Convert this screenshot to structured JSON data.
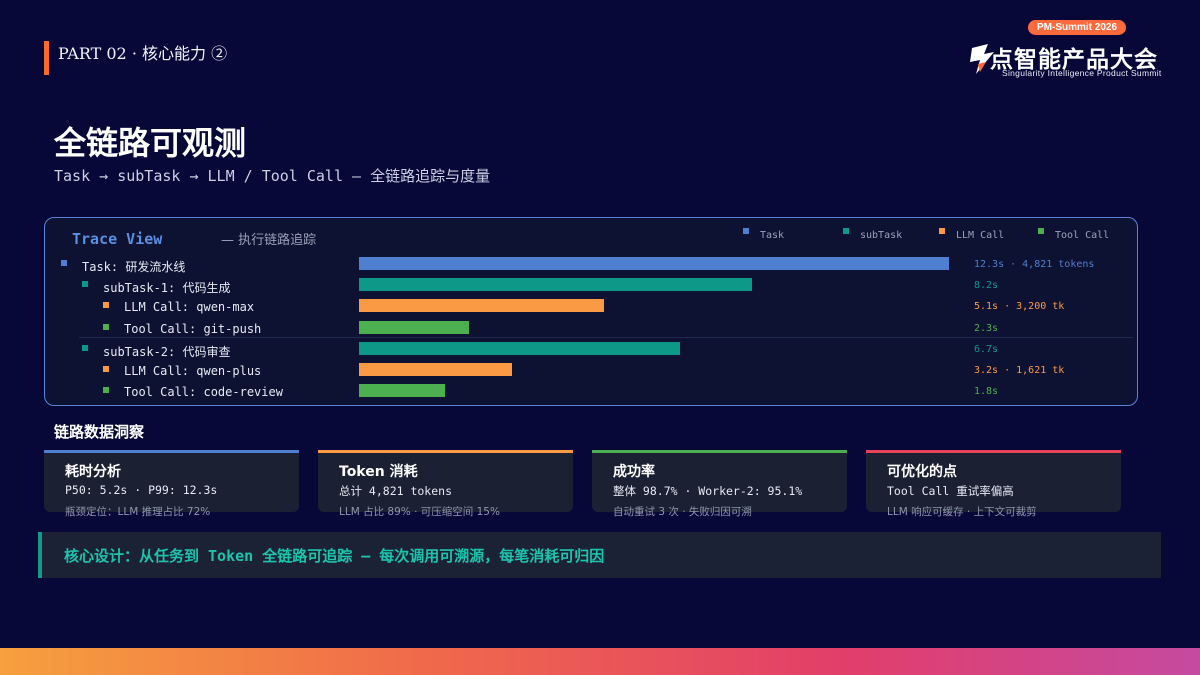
{
  "header": {
    "part_label": "PART 02 · 核心能力 ②",
    "logo": {
      "badge": "PM-Summit 2026",
      "name": "点智能产品大会",
      "subtitle": "Singularity Intelligence Product Summit",
      "icon": "summit-logo-icon"
    }
  },
  "title": "全链路可观测",
  "subtitle": "Task → subTask → LLM / Tool Call — 全链路追踪与度量",
  "trace": {
    "title": "Trace View",
    "subtitle": "— 执行链路追踪",
    "legend": [
      {
        "label": "Task",
        "color": "#4f7fd0"
      },
      {
        "label": "subTask",
        "color": "#0e9888"
      },
      {
        "label": "LLM Call",
        "color": "#fb9a44"
      },
      {
        "label": "Tool Call",
        "color": "#4caf50"
      }
    ],
    "rows": [
      {
        "label": "Task: 研发流水线",
        "kind": "task",
        "level": 0,
        "duration_s": 12.3,
        "value": "12.3s · 4,821 tokens"
      },
      {
        "label": "subTask-1: 代码生成",
        "kind": "subtask",
        "level": 1,
        "duration_s": 8.2,
        "value": "8.2s"
      },
      {
        "label": "LLM Call: qwen-max",
        "kind": "llm",
        "level": 2,
        "duration_s": 5.1,
        "value": "5.1s · 3,200 tk"
      },
      {
        "label": "Tool Call: git-push",
        "kind": "tool",
        "level": 2,
        "duration_s": 2.3,
        "value": "2.3s"
      },
      {
        "label": "subTask-2: 代码审查",
        "kind": "subtask",
        "level": 1,
        "duration_s": 6.7,
        "value": "6.7s"
      },
      {
        "label": "LLM Call: qwen-plus",
        "kind": "llm",
        "level": 2,
        "duration_s": 3.2,
        "value": "3.2s · 1,621 tk"
      },
      {
        "label": "Tool Call: code-review",
        "kind": "tool",
        "level": 2,
        "duration_s": 1.8,
        "value": "1.8s"
      }
    ]
  },
  "insights": {
    "title": "链路数据洞察",
    "cards": [
      {
        "title": "耗时分析",
        "line1": "P50: 5.2s  ·  P99: 12.3s",
        "line2": "瓶颈定位：LLM 推理占比 72%",
        "color": "#4f7fd0"
      },
      {
        "title": "Token 消耗",
        "line1": "总计 4,821 tokens",
        "line2": "LLM 占比 89% · 可压缩空间 15%",
        "color": "#fb9a44"
      },
      {
        "title": "成功率",
        "line1": "整体 98.7% · Worker-2: 95.1%",
        "line2": "自动重试 3 次 · 失败归因可溯",
        "color": "#4caf50"
      },
      {
        "title": "可优化的点",
        "line1": "Tool Call 重试率偏高",
        "line2": "LLM 响应可缓存 · 上下文可裁剪",
        "color": "#e8425a"
      }
    ]
  },
  "core": "核心设计：从任务到 Token 全链路可追踪 — 每次调用可溯源，每笔消耗可归因"
}
